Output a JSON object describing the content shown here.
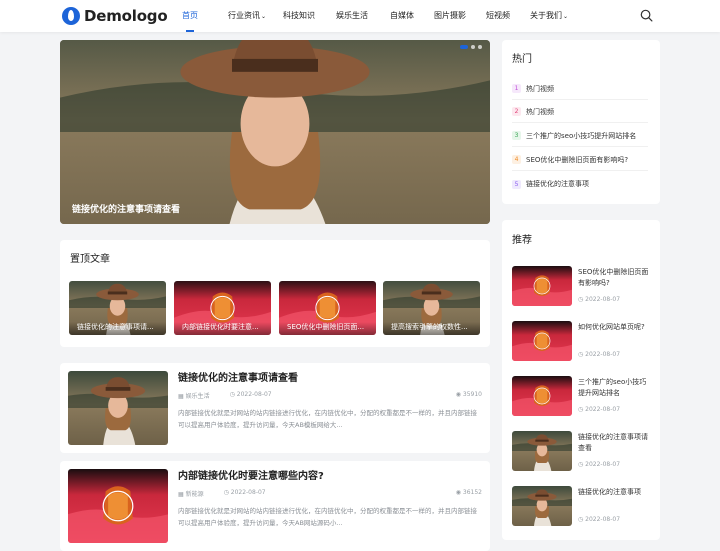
{
  "header": {
    "logo_text": "Demologo",
    "nav": [
      {
        "label": "首页",
        "active": true,
        "dropdown": false
      },
      {
        "label": "行业资讯",
        "active": false,
        "dropdown": true
      },
      {
        "label": "科技知识",
        "active": false,
        "dropdown": false
      },
      {
        "label": "娱乐生活",
        "active": false,
        "dropdown": false
      },
      {
        "label": "自媒体",
        "active": false,
        "dropdown": false
      },
      {
        "label": "图片摄影",
        "active": false,
        "dropdown": false
      },
      {
        "label": "短视频",
        "active": false,
        "dropdown": false
      },
      {
        "label": "关于我们",
        "active": false,
        "dropdown": true
      }
    ],
    "caret": "⌄"
  },
  "hero": {
    "caption": "链接优化的注意事项请查看",
    "slides": 3,
    "active_slide": 1
  },
  "pinned": {
    "title": "置顶文章",
    "items": [
      {
        "caption": "链接优化的注意事项请...",
        "image": "woman-hat"
      },
      {
        "caption": "内部链接优化时要注意...",
        "image": "red-fabric"
      },
      {
        "caption": "SEO优化中删除旧页面...",
        "image": "red-fabric"
      },
      {
        "caption": "提高搜索引擎的权数性...",
        "image": "woman-hat"
      }
    ]
  },
  "articles": [
    {
      "title": "链接优化的注意事项请查看",
      "category": "娱乐生活",
      "date": "2022-08-07",
      "views": "35910",
      "excerpt": "内部链接优化就是对网站的站内链接进行优化，在内链优化中，分配的权重都是不一样的，并且内部链接可以提高用户体验度，提升访问量，今天AB模板网给大...",
      "image": "woman-hat"
    },
    {
      "title": "内部链接优化时要注意哪些内容?",
      "category": "新能源",
      "date": "2022-08-07",
      "views": "36152",
      "excerpt": "内部链接优化就是对网站的站内链接进行优化，在内链优化中，分配的权重都是不一样的，并且内部链接可以提高用户体验度，提升访问量，今天AB网站源码小...",
      "image": "red-fabric"
    }
  ],
  "sidebar": {
    "hot": {
      "title": "热门",
      "items": [
        {
          "num": "1",
          "label": "热门视频",
          "color": "#c04fd8",
          "bg": "#f6e8fb"
        },
        {
          "num": "2",
          "label": "热门视频",
          "color": "#e0457a",
          "bg": "#fde8ef"
        },
        {
          "num": "3",
          "label": "三个推广的seo小技巧提升网站排名",
          "color": "#3aa655",
          "bg": "#e6f6ea"
        },
        {
          "num": "4",
          "label": "SEO优化中删除旧页面有影响吗?",
          "color": "#f08a24",
          "bg": "#fdf0e2"
        },
        {
          "num": "5",
          "label": "链接优化的注意事项",
          "color": "#8a5cf0",
          "bg": "#efe9fd"
        }
      ]
    },
    "recommend": {
      "title": "推荐",
      "items": [
        {
          "title": "SEO优化中删除旧页面有影响吗?",
          "date": "2022-08-07",
          "image": "red-fabric"
        },
        {
          "title": "如何优化网站单页呢?",
          "date": "2022-08-07",
          "image": "red-fabric"
        },
        {
          "title": "三个推广的seo小技巧提升网站排名",
          "date": "2022-08-07",
          "image": "red-fabric"
        },
        {
          "title": "链接优化的注意事项请查看",
          "date": "2022-08-07",
          "image": "woman-hat"
        },
        {
          "title": "链接优化的注意事项",
          "date": "2022-08-07",
          "image": "woman-hat"
        }
      ]
    }
  },
  "colors": {
    "accent": "#1d64d8",
    "page_bg": "#f3f4f6"
  }
}
